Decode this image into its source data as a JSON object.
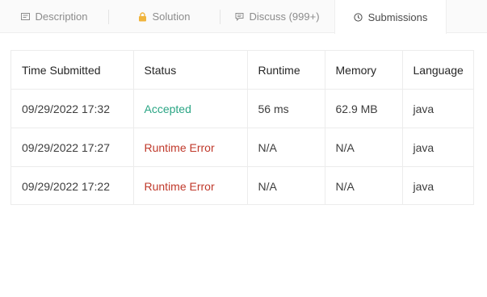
{
  "tabs": [
    {
      "label": "Description",
      "icon": "description-icon"
    },
    {
      "label": "Solution",
      "icon": "lock-icon"
    },
    {
      "label": "Discuss (999+)",
      "icon": "comment-icon"
    },
    {
      "label": "Submissions",
      "icon": "clock-icon"
    }
  ],
  "active_tab": "Submissions",
  "colors": {
    "accepted": "#2aa584",
    "error": "#c0392b",
    "lock": "#f0b43c"
  },
  "table": {
    "headers": [
      "Time Submitted",
      "Status",
      "Runtime",
      "Memory",
      "Language"
    ],
    "rows": [
      {
        "time": "09/29/2022 17:32",
        "status": "Accepted",
        "runtime": "56 ms",
        "memory": "62.9 MB",
        "language": "java"
      },
      {
        "time": "09/29/2022 17:27",
        "status": "Runtime Error",
        "runtime": "N/A",
        "memory": "N/A",
        "language": "java"
      },
      {
        "time": "09/29/2022 17:22",
        "status": "Runtime Error",
        "runtime": "N/A",
        "memory": "N/A",
        "language": "java"
      }
    ]
  }
}
